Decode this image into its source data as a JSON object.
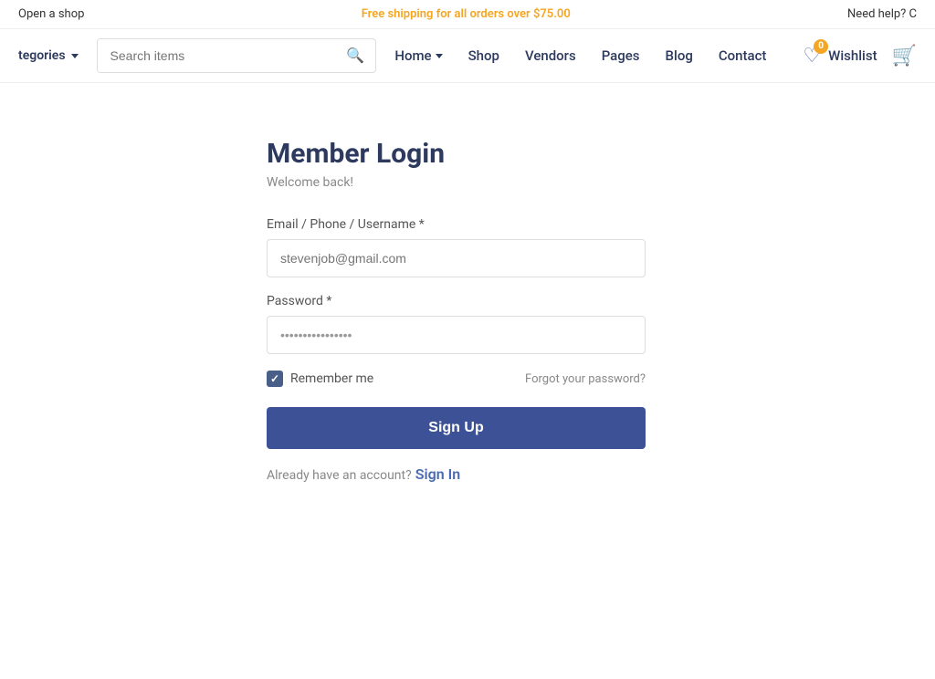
{
  "topbar": {
    "open_shop": "Open a shop",
    "free_shipping_text": "Free shipping for all orders over ",
    "free_shipping_amount": "$75.00",
    "need_help": "Need help? C"
  },
  "header": {
    "categories_label": "tegories",
    "search_placeholder": "Search items",
    "nav_items": [
      {
        "label": "Home",
        "has_dropdown": true
      },
      {
        "label": "Shop",
        "has_dropdown": false
      },
      {
        "label": "Vendors",
        "has_dropdown": false
      },
      {
        "label": "Pages",
        "has_dropdown": false
      },
      {
        "label": "Blog",
        "has_dropdown": false
      },
      {
        "label": "Contact",
        "has_dropdown": false
      }
    ],
    "wishlist_label": "Wishlist",
    "wishlist_badge": "0",
    "cart_icon": "🛒"
  },
  "login_form": {
    "title": "Member Login",
    "subtitle": "Welcome back!",
    "email_label": "Email / Phone / Username",
    "email_placeholder": "stevenjob@gmail.com",
    "password_label": "Password",
    "password_placeholder": "••••••••••••••••",
    "remember_me_label": "Remember me",
    "forgot_password_label": "Forgot your password?",
    "sign_up_button": "Sign Up",
    "already_account_text": "Already have an account?",
    "sign_in_link": "Sign In"
  }
}
